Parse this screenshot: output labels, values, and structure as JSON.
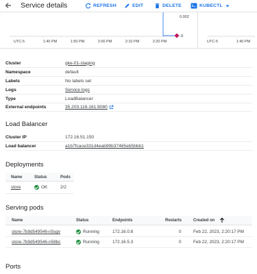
{
  "header": {
    "title": "Service details",
    "refresh": "REFRESH",
    "edit": "EDIT",
    "delete": "DELETE",
    "kubectl": "KUBECTL"
  },
  "chart": {
    "value_label": "0.002",
    "timezone": "UTC-5",
    "ticks": [
      "1:40 PM",
      "1:50 PM",
      "2:00 PM",
      "2:10 PM",
      "2:20 PM"
    ],
    "timezone2": "UTC-5",
    "tick2": "1:40 PM",
    "mini_value": "0"
  },
  "details": {
    "rows": [
      {
        "key": "Cluster",
        "value": "gke-01-staging"
      },
      {
        "key": "Namespace",
        "value": "default"
      },
      {
        "key": "Labels",
        "value": "No labels set"
      },
      {
        "key": "Logs",
        "value": "Service logs"
      },
      {
        "key": "Type",
        "value": "LoadBalancer"
      },
      {
        "key": "External endpoints",
        "value": "35.203.116.161:8080"
      }
    ]
  },
  "load_balancer": {
    "heading": "Load Balancer",
    "rows": [
      {
        "key": "Cluster IP",
        "value": "172.16.51.150"
      },
      {
        "key": "Load balancer",
        "value": "a1b7fcace331d4eab99b37465eb5bbb1"
      }
    ]
  },
  "deployments": {
    "heading": "Deployments",
    "columns": [
      "Name",
      "Status",
      "Pods"
    ],
    "rows": [
      {
        "name": "store",
        "status": "OK",
        "pods": "2/2"
      }
    ]
  },
  "serving_pods": {
    "heading": "Serving pods",
    "columns": [
      "Name",
      "Status",
      "Endpoints",
      "Restarts",
      "Created on"
    ],
    "rows": [
      {
        "name": "store-7b9d549546-n5sgv",
        "status": "Running",
        "endpoint": "172.16.0.8",
        "restarts": "0",
        "created": "Feb 22, 2023, 2:20:17 PM"
      },
      {
        "name": "store-7b9d549546-n58bc",
        "status": "Running",
        "endpoint": "172.16.5.3",
        "restarts": "0",
        "created": "Feb 22, 2023, 2:20:17 PM"
      }
    ]
  },
  "ports": {
    "heading": "Ports"
  },
  "colors": {
    "accent": "#1a73e8",
    "ok": "#1e8e3e",
    "marker": "#c2185b"
  }
}
